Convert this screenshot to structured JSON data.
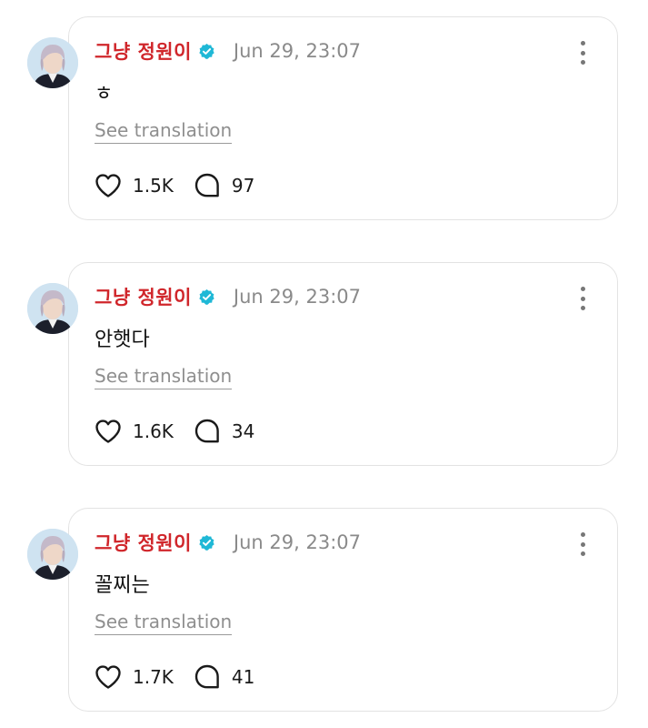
{
  "posts": [
    {
      "author": "그냥 정원이",
      "timestamp": "Jun 29, 23:07",
      "text": "ㅎ",
      "translate_label": "See translation",
      "likes": "1.5K",
      "comments": "97"
    },
    {
      "author": "그냥 정원이",
      "timestamp": "Jun 29, 23:07",
      "text": "안햇다",
      "translate_label": "See translation",
      "likes": "1.6K",
      "comments": "34"
    },
    {
      "author": "그냥 정원이",
      "timestamp": "Jun 29, 23:07",
      "text": "꼴찌는",
      "translate_label": "See translation",
      "likes": "1.7K",
      "comments": "41"
    }
  ],
  "colors": {
    "author": "#d0262b",
    "verified": "#1fb8d6",
    "muted": "#8a8a8a",
    "border": "#e3e3e3"
  },
  "icons": {
    "verified": "verified-badge-icon",
    "more": "more-vertical-icon",
    "like": "heart-icon",
    "comment": "comment-bubble-icon"
  }
}
